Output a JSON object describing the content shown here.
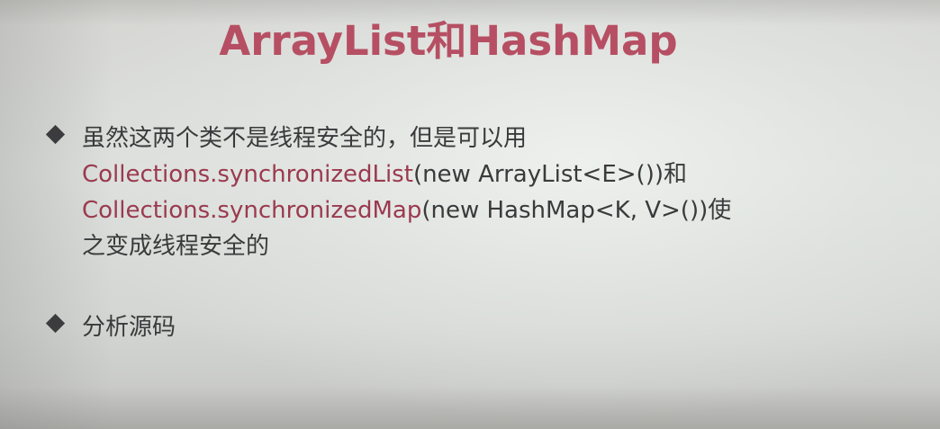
{
  "slide": {
    "title": "ArrayList和HashMap",
    "bullets": [
      {
        "lines": [
          {
            "segments": [
              {
                "text": "虽然这两个类不是线程安全的，但是可以用",
                "color": "dark"
              }
            ]
          },
          {
            "segments": [
              {
                "text": "Collections.synchronizedList",
                "color": "red"
              },
              {
                "text": "(new ArrayList<E>())和",
                "color": "dark"
              }
            ]
          },
          {
            "segments": [
              {
                "text": "Collections.synchronizedMap",
                "color": "red"
              },
              {
                "text": "(new HashMap<K, V>())使",
                "color": "dark"
              }
            ]
          },
          {
            "segments": [
              {
                "text": "之变成线程安全的",
                "color": "dark"
              }
            ]
          }
        ]
      },
      {
        "lines": [
          {
            "segments": [
              {
                "text": "分析源码",
                "color": "dark"
              }
            ]
          }
        ]
      }
    ]
  },
  "colors": {
    "title": "#b64f63",
    "accent_code": "#9a3a4e",
    "body_text": "#3a3a3c",
    "bullet_marker": "#3c3c3e"
  }
}
